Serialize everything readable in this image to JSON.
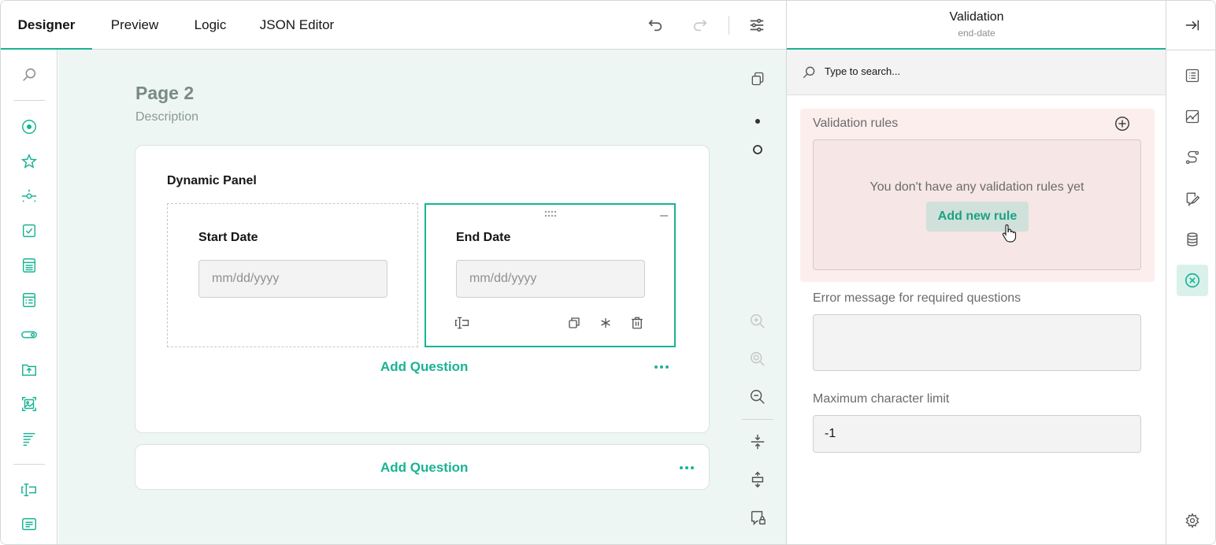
{
  "tabs": [
    "Designer",
    "Preview",
    "Logic",
    "JSON Editor"
  ],
  "page": {
    "title": "Page 2",
    "description": "Description"
  },
  "panel": {
    "title": "Dynamic Panel",
    "questions": [
      {
        "title": "Start Date",
        "placeholder": "mm/dd/yyyy"
      },
      {
        "title": "End Date",
        "placeholder": "mm/dd/yyyy"
      }
    ],
    "add_question": "Add Question"
  },
  "page_add_question": "Add Question",
  "property_grid": {
    "title": "Validation",
    "subtitle": "end-date",
    "search_placeholder": "Type to search...",
    "validation_rules_label": "Validation rules",
    "empty_rules_text": "You don't have any validation rules yet",
    "add_rule_label": "Add new rule",
    "required_error_label": "Error message for required questions",
    "required_error_value": "",
    "max_length_label": "Maximum character limit",
    "max_length_value": "-1"
  },
  "colors": {
    "accent": "#19b394",
    "canvas": "#edf6f3",
    "error_bg": "#fdeeee"
  }
}
